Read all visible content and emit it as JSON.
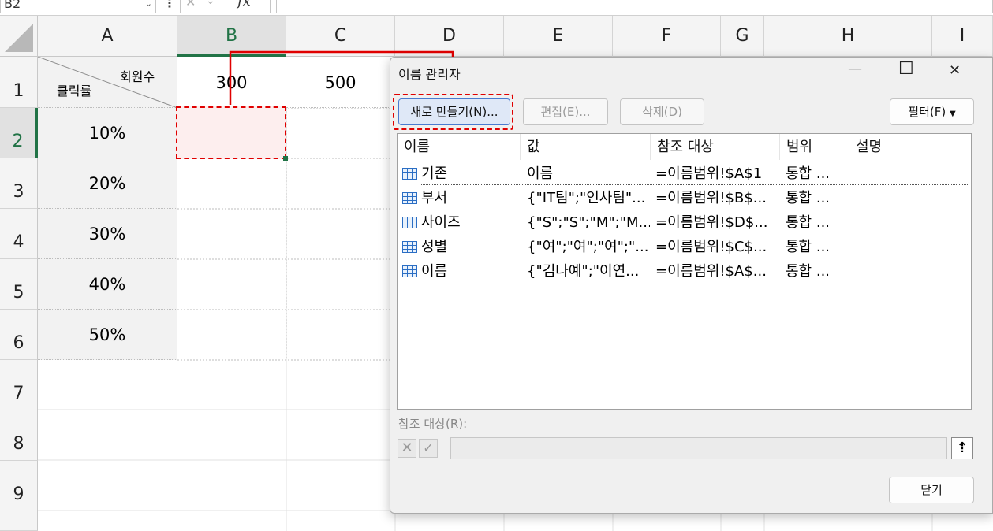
{
  "formula_bar": {
    "name_box": "B2",
    "fx": "fx"
  },
  "sheet": {
    "columns": [
      "A",
      "B",
      "C",
      "D",
      "E",
      "F",
      "G",
      "H",
      "I"
    ],
    "rows": [
      "1",
      "2",
      "3",
      "4",
      "5",
      "6",
      "7",
      "8",
      "9"
    ],
    "a1_top_label": "회원수",
    "a1_bottom_label": "클릭률",
    "row1_values": [
      "300",
      "500"
    ],
    "col_a_values": [
      "10%",
      "20%",
      "30%",
      "40%",
      "50%"
    ]
  },
  "dialog": {
    "title": "이름 관리자",
    "buttons": {
      "new": "새로 만들기(N)...",
      "edit": "편집(E)...",
      "delete": "삭제(D)",
      "filter": "필터(F)",
      "close": "닫기"
    },
    "headers": [
      "이름",
      "값",
      "참조 대상",
      "범위",
      "설명"
    ],
    "rows": [
      {
        "name": "기존",
        "value": "이름",
        "ref": "=이름범위!$A$1",
        "scope": "통합 ..."
      },
      {
        "name": "부서",
        "value": "{\"IT팀\";\"인사팀\"...",
        "ref": "=이름범위!$B$...",
        "scope": "통합 ..."
      },
      {
        "name": "사이즈",
        "value": "{\"S\";\"S\";\"M\";\"M...",
        "ref": "=이름범위!$D$...",
        "scope": "통합 ..."
      },
      {
        "name": "성별",
        "value": "{\"여\";\"여\";\"여\";\"...",
        "ref": "=이름범위!$C$...",
        "scope": "통합 ..."
      },
      {
        "name": "이름",
        "value": "{\"김나예\";\"이연...",
        "ref": "=이름범위!$A$...",
        "scope": "통합 ..."
      }
    ],
    "ref_label": "참조 대상(R):"
  },
  "colors": {
    "accent_green": "#217346",
    "highlight_red": "#e00000",
    "selected_cell_fill": "#fdeeee"
  }
}
